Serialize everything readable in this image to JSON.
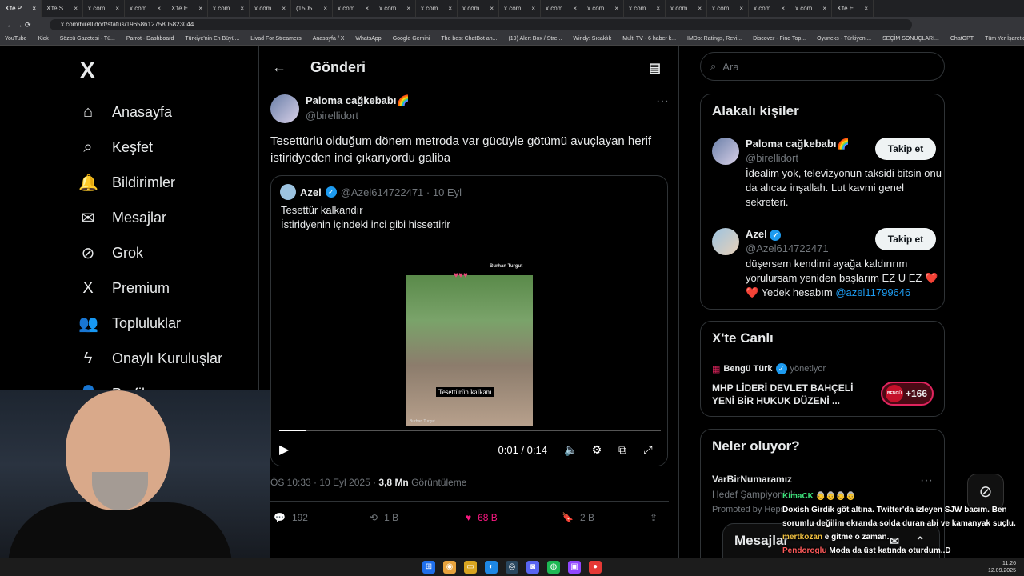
{
  "browser": {
    "tabs": [
      "X'te P",
      "X'te S",
      "x.com",
      "x.com",
      "X'te E",
      "x.com",
      "x.com",
      "(1505",
      "x.com",
      "x.com",
      "x.com",
      "x.com",
      "x.com",
      "x.com",
      "x.com",
      "x.com",
      "x.com",
      "x.com",
      "x.com",
      "x.com",
      "X'te E"
    ],
    "url": "x.com/birellidort/status/1965861275805823044",
    "bookmarks": [
      "YouTube",
      "Kick",
      "Sözcü Gazetesi - Tü...",
      "Parrot - Dashboard",
      "Türkiye'nin En Büyü...",
      "Livad For Streamers",
      "Anasayfa / X",
      "WhatsApp",
      "Google Gemini",
      "The best ChatBot an...",
      "(19) Alert Box / Stre...",
      "Windy: Sıcaklık",
      "Multi TV - 6 haber k...",
      "IMDb: Ratings, Revi...",
      "Discover - Find Top...",
      "Oyuneks - Türkiyeni...",
      "SEÇİM SONUÇLARI...",
      "ChatGPT",
      "Tüm Yer İşaretleri"
    ]
  },
  "nav": {
    "logo": "X",
    "items": [
      {
        "label": "Anasayfa",
        "icon": "⌂"
      },
      {
        "label": "Keşfet",
        "icon": "⌕"
      },
      {
        "label": "Bildirimler",
        "icon": "🔔"
      },
      {
        "label": "Mesajlar",
        "icon": "✉"
      },
      {
        "label": "Grok",
        "icon": "⊘"
      },
      {
        "label": "Premium",
        "icon": "X"
      },
      {
        "label": "Topluluklar",
        "icon": "👥"
      },
      {
        "label": "Onaylı Kuruluşlar",
        "icon": "ϟ"
      },
      {
        "label": "Profil",
        "icon": "👤"
      }
    ]
  },
  "header": {
    "back": "←",
    "title": "Gönderi",
    "reader": "▤"
  },
  "post": {
    "name": "Paloma cağkebabı🌈",
    "handle": "@birellidort",
    "more": "···",
    "text": "Tesettürlü olduğum dönem metroda var gücüyle götümü avuçlayan herif istiridyeden inci çıkarıyordu galiba",
    "meta_time": "ÖS 10:33 · 10 Eyl 2025 · ",
    "views": "3,8 Mn",
    "views_label": " Görüntüleme",
    "actions": {
      "replies": "192",
      "reposts": "1 B",
      "likes": "68 B",
      "bookmarks": "2 B"
    }
  },
  "quote": {
    "name": "Azel",
    "handle": "@Azel614722471 · 10 Eyl",
    "line1": "Tesettür kalkandır",
    "line2": "İstiridyenin içindeki inci gibi hissettirir",
    "video_title": "Burhan Turgut",
    "video_caption": "Tesettürün kalkanı",
    "video_watermark": "Burhan Turgut",
    "time": "0:01 / 0:14",
    "progress": 0.07
  },
  "sidebar": {
    "search_placeholder": "Ara",
    "related_title": "Alakalı kişiler",
    "people": [
      {
        "name": "Paloma cağkebabı🌈",
        "handle": "@birellidort",
        "bio": "İdealim yok, televizyonun taksidi bitsin onu da alıcaz inşallah. Lut kavmi genel sekreteri.",
        "follow": "Takip et"
      },
      {
        "name": "Azel",
        "handle": "@Azel614722471",
        "bio": "düşersem kendimi ayağa kaldırırım yorulursam yeniden başlarım EZ U EZ ❤️❤️ Yedek hesabım ",
        "bio_link": "@azel11799646",
        "follow": "Takip et"
      }
    ],
    "live_title": "X'te Canlı",
    "live_host": "Bengü Türk",
    "live_role": "yönetiyor",
    "live_headline": "MHP LİDERİ DEVLET BAHÇELİ YENİ BİR HUKUK DÜZENİ ...",
    "live_count": "+166",
    "trends_title": "Neler oluyor?",
    "trend_name": "VarBirNumaramız",
    "trend_sub": "Hedef Şampiyonluk",
    "trend_promo": "Promoted by Heps",
    "messages": "Mesajlar"
  },
  "chat": [
    {
      "user": "KimaCK",
      "text": "👵👵👵👵"
    },
    {
      "user": "Doxish",
      "text": "Girdik göt altına. Twitter'da izleyen SJW bacım. Ben sorumlu değilim ekranda solda duran abi ve kamanyak suçlu."
    },
    {
      "user": "mertkozan",
      "text": "e gitme o zaman."
    },
    {
      "user": "Pendoroglu",
      "text": "Moda da üst katında oturdum..D"
    }
  ],
  "clock": {
    "time": "11:26",
    "date": "12.09.2025"
  }
}
